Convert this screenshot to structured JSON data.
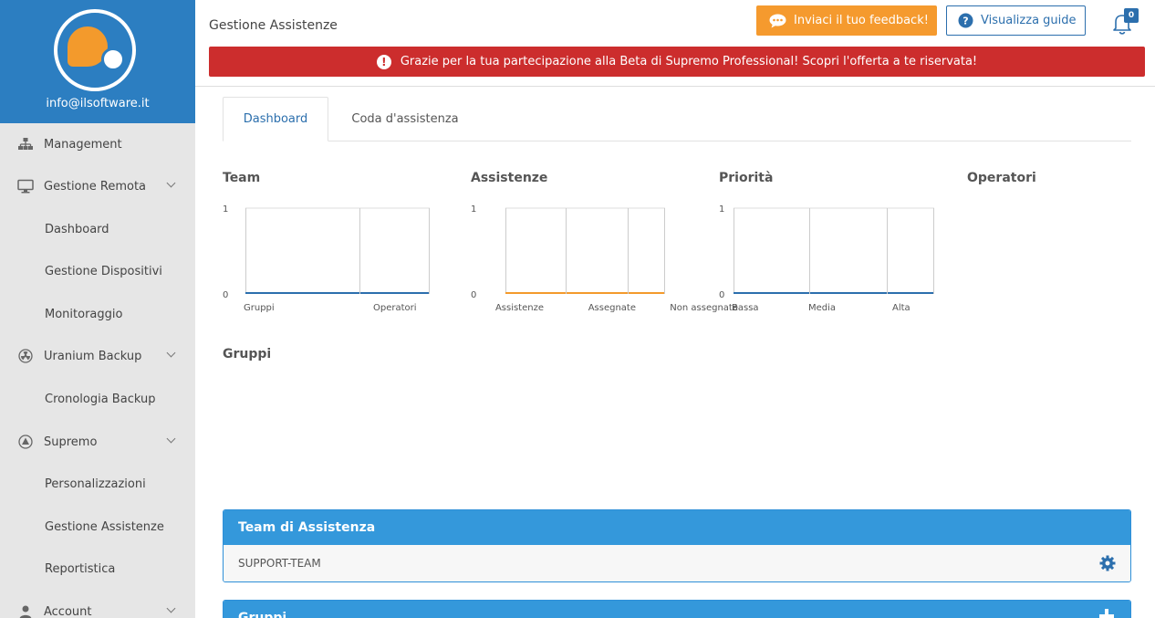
{
  "sidebar": {
    "user_email": "info@ilsoftware.it",
    "items": [
      {
        "label": "Management",
        "icon": "sitemap-icon",
        "type": "main",
        "chevron": false
      },
      {
        "label": "Gestione Remota",
        "icon": "monitor-icon",
        "type": "main",
        "chevron": true
      },
      {
        "label": "Dashboard",
        "type": "sub"
      },
      {
        "label": "Gestione Dispositivi",
        "type": "sub"
      },
      {
        "label": "Monitoraggio",
        "type": "sub"
      },
      {
        "label": "Uranium Backup",
        "icon": "radiation-icon",
        "type": "main",
        "chevron": true
      },
      {
        "label": "Cronologia Backup",
        "type": "sub"
      },
      {
        "label": "Supremo",
        "icon": "supremo-icon",
        "type": "main",
        "chevron": true
      },
      {
        "label": "Personalizzazioni",
        "type": "sub"
      },
      {
        "label": "Gestione Assistenze",
        "type": "sub"
      },
      {
        "label": "Reportistica",
        "type": "sub"
      },
      {
        "label": "Account",
        "icon": "user-icon",
        "type": "main",
        "chevron": true
      }
    ]
  },
  "header": {
    "title": "Gestione Assistenze",
    "feedback_label": "Inviaci il tuo feedback!",
    "guide_label": "Visualizza guide",
    "notification_count": "0",
    "alert_text": "Grazie per la tua partecipazione alla Beta di Supremo Professional! Scopri l'offerta a te riservata!"
  },
  "tabs": [
    {
      "label": "Dashboard",
      "active": true
    },
    {
      "label": "Coda d'assistenza",
      "active": false
    }
  ],
  "colors": {
    "brand_blue": "#2c7ec1",
    "accent_orange": "#f59a2e",
    "alert_red": "#cc2d2d",
    "series_blue": "#2c6fad",
    "series_orange": "#f39a2c"
  },
  "chart_data": [
    {
      "type": "bar",
      "title": "Team",
      "categories": [
        "Gruppi",
        "Operatori"
      ],
      "values": [
        0,
        0
      ],
      "ylim": [
        0,
        1
      ],
      "yticks": [
        "1",
        "0"
      ],
      "color": "#2c6fad"
    },
    {
      "type": "bar",
      "title": "Assistenze",
      "categories": [
        "Assistenze",
        "Assegnate",
        "Non assegnate"
      ],
      "values": [
        0,
        0,
        0
      ],
      "ylim": [
        0,
        1
      ],
      "yticks": [
        "1",
        "0"
      ],
      "color": "#f39a2c"
    },
    {
      "type": "bar",
      "title": "Priorità",
      "categories": [
        "Bassa",
        "Media",
        "Alta"
      ],
      "values": [
        0,
        0,
        0
      ],
      "ylim": [
        0,
        1
      ],
      "yticks": [
        "1",
        "0"
      ],
      "color": "#2c6fad"
    },
    {
      "type": "bar",
      "title": "Operatori",
      "categories": [],
      "values": []
    }
  ],
  "groups_section": {
    "title": "Gruppi"
  },
  "team_panel": {
    "title": "Team di Assistenza",
    "rows": [
      {
        "name": "SUPPORT-TEAM"
      }
    ]
  },
  "groups_panel": {
    "title": "Gruppi"
  }
}
